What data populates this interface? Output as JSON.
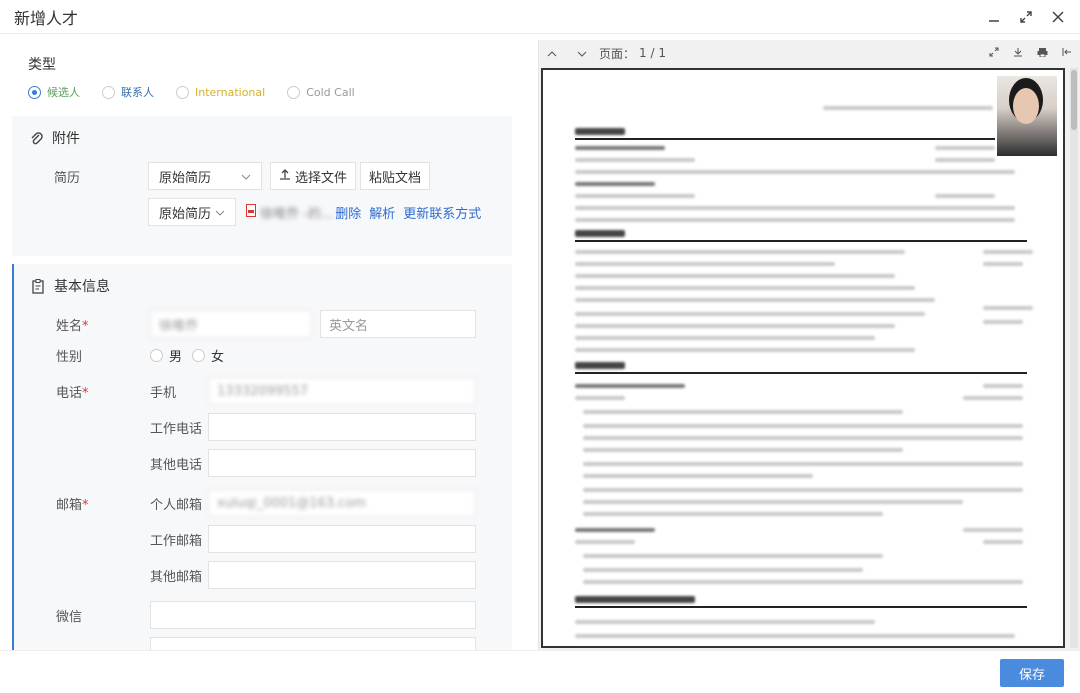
{
  "window": {
    "title": "新增人才"
  },
  "type_section": {
    "label": "类型",
    "options": [
      {
        "label": "候选人",
        "checked": true
      },
      {
        "label": "联系人",
        "checked": false
      },
      {
        "label": "International",
        "checked": false
      },
      {
        "label": "Cold Call",
        "checked": false
      }
    ]
  },
  "attachment": {
    "title": "附件",
    "resume_label": "简历",
    "select1": "原始简历",
    "choose_file": "选择文件",
    "paste_doc": "粘贴文档",
    "select2": "原始简历",
    "file_name": "徐唯乔 -的...",
    "actions": {
      "delete": "删除",
      "parse": "解析",
      "update_contact": "更新联系方式"
    }
  },
  "basic": {
    "title": "基本信息",
    "name_label": "姓名",
    "name_value": "徐唯乔",
    "english_name_placeholder": "英文名",
    "gender_label": "性别",
    "gender_male": "男",
    "gender_female": "女",
    "phone_label": "电话",
    "mobile_label": "手机",
    "mobile_value": "13332099557",
    "work_phone_label": "工作电话",
    "other_phone_label": "其他电话",
    "email_label": "邮箱",
    "personal_email_label": "个人邮箱",
    "personal_email_value": "xuluqi_0001@163.com",
    "work_email_label": "工作邮箱",
    "other_email_label": "其他邮箱",
    "wechat_label": "微信",
    "required_mark": "*"
  },
  "preview": {
    "page_label": "页面：",
    "page_value": "1 / 1"
  },
  "footer": {
    "save_label": "保存"
  }
}
